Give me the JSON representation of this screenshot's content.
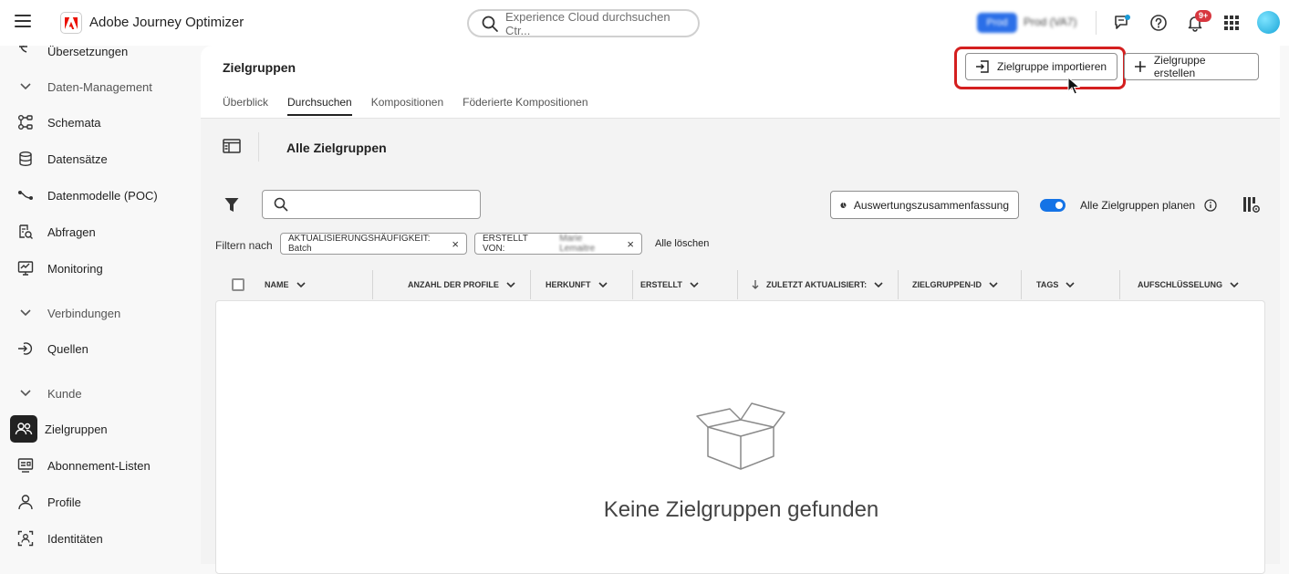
{
  "app": {
    "name": "Adobe Journey Optimizer"
  },
  "search": {
    "placeholder": "Experience Cloud durchsuchen Ctr..."
  },
  "environment": {
    "badge": "Prod",
    "name": "Prod (VA7)"
  },
  "notifications": {
    "count": "9+"
  },
  "sidebar": {
    "partial_item": "Übersetzungen",
    "sections": [
      {
        "label": "Daten-Management",
        "items": [
          "Schemata",
          "Datensätze",
          "Datenmodelle (POC)",
          "Abfragen",
          "Monitoring"
        ]
      },
      {
        "label": "Verbindungen",
        "items": [
          "Quellen"
        ]
      },
      {
        "label": "Kunde",
        "items": [
          "Zielgruppen",
          "Abonnement-Listen",
          "Profile",
          "Identitäten"
        ]
      }
    ],
    "active_item": "Zielgruppen"
  },
  "page": {
    "title": "Zielgruppen",
    "tabs": [
      "Überblick",
      "Durchsuchen",
      "Kompositionen",
      "Föderierte Kompositionen"
    ],
    "active_tab": "Durchsuchen",
    "import_button": "Zielgruppe importieren",
    "create_button": "Zielgruppe erstellen"
  },
  "toolbar": {
    "title": "Alle Zielgruppen",
    "summary_button": "Auswertungszusammenfassung",
    "toggle_label": "Alle Zielgruppen planen",
    "toggle_on": true
  },
  "filters": {
    "label": "Filtern nach",
    "chips": [
      {
        "text": "AKTUALISIERUNGSHÄUFIGKEIT: Batch",
        "value": ""
      },
      {
        "text": "ERSTELLT VON:",
        "value": "Marie Lemaitre"
      }
    ],
    "clear_all": "Alle löschen"
  },
  "table": {
    "columns": [
      "NAME",
      "ANZAHL DER PROFILE",
      "HERKUNFT",
      "ERSTELLT",
      "ZULETZT AKTUALISIERT:",
      "ZIELGRUPPEN-ID",
      "TAGS",
      "AUFSCHLÜSSELUNG"
    ],
    "empty_message": "Keine Zielgruppen gefunden"
  },
  "colors": {
    "accent": "#1473e6",
    "highlight": "#d41f1f",
    "adobe_red": "#eb1000",
    "badge": "#d7373f"
  }
}
